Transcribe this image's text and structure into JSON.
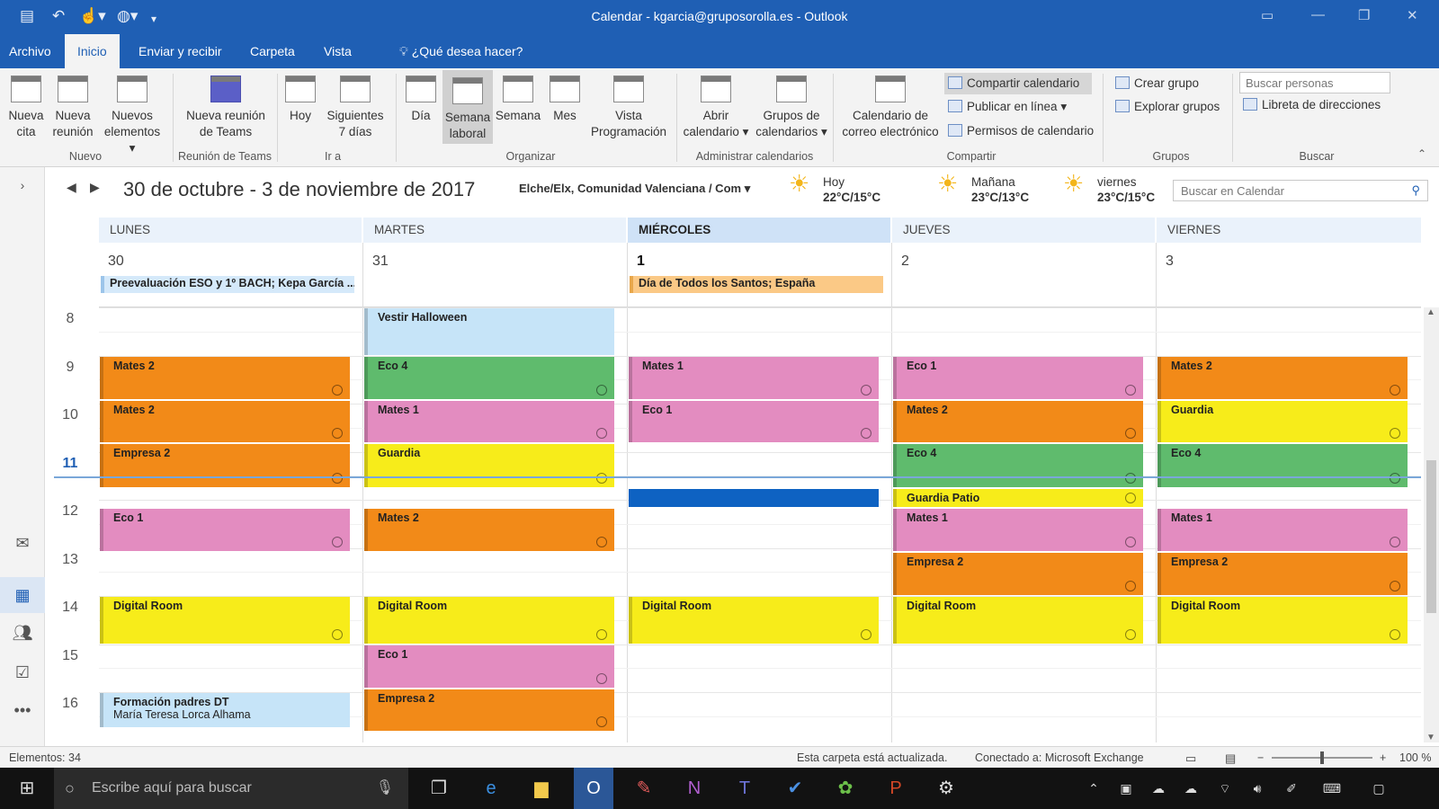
{
  "window": {
    "title": "Calendar - kgarcia@gruposorolla.es - Outlook"
  },
  "tabs": [
    "Archivo",
    "Inicio",
    "Enviar y recibir",
    "Carpeta",
    "Vista",
    "¿Qué desea hacer?"
  ],
  "ribbon": {
    "nueva_cita": "Nueva\ncita",
    "nueva_reunion": "Nueva\nreunión",
    "nuevos_elementos": "Nuevos\nelementos ▾",
    "teams": "Nueva reunión\nde Teams",
    "hoy": "Hoy",
    "siguientes": "Siguientes\n7 días",
    "dia": "Día",
    "semana_laboral": "Semana\nlaboral",
    "semana": "Semana",
    "mes": "Mes",
    "vista_prog": "Vista\nProgramación",
    "abrir": "Abrir\ncalendario ▾",
    "grupos_cal": "Grupos de\ncalendarios ▾",
    "cal_correo": "Calendario de\ncorreo electrónico",
    "compartir": "Compartir calendario",
    "publicar": "Publicar en línea ▾",
    "permisos": "Permisos de calendario",
    "crear_grupo": "Crear grupo",
    "explorar": "Explorar grupos",
    "buscar_personas": "Buscar personas",
    "libreta": "Libreta de direcciones",
    "groups": {
      "nuevo": "Nuevo",
      "teams": "Reunión de Teams",
      "ira": "Ir a",
      "organizar": "Organizar",
      "admin": "Administrar calendarios",
      "compartir": "Compartir",
      "grupos": "Grupos",
      "buscar": "Buscar"
    }
  },
  "header": {
    "date_range": "30 de octubre - 3 de noviembre de 2017",
    "location": "Elche/Elx, Comunidad Valenciana / Com",
    "weather": [
      {
        "label": "Hoy",
        "temp": "22°C/15°C"
      },
      {
        "label": "Mañana",
        "temp": "23°C/13°C"
      },
      {
        "label": "viernes",
        "temp": "23°C/15°C"
      }
    ],
    "search_placeholder": "Buscar en Calendar"
  },
  "days": [
    {
      "name": "LUNES",
      "num": "30"
    },
    {
      "name": "MARTES",
      "num": "31"
    },
    {
      "name": "MIÉRCOLES",
      "num": "1"
    },
    {
      "name": "JUEVES",
      "num": "2"
    },
    {
      "name": "VIERNES",
      "num": "3"
    }
  ],
  "allday": [
    "Preevaluación ESO y 1º BACH; Kepa García ...",
    "Día de Todos los Santos; España"
  ],
  "hours": [
    "8",
    "9",
    "10",
    "11",
    "12",
    "13",
    "14",
    "15",
    "16"
  ],
  "events": [
    {
      "day": 0,
      "start": 9,
      "end": 9.92,
      "title": "Mates 2",
      "color": "orange",
      "recurring": true
    },
    {
      "day": 0,
      "start": 9.92,
      "end": 10.83,
      "title": "Mates 2",
      "color": "orange",
      "recurring": true
    },
    {
      "day": 0,
      "start": 10.83,
      "end": 11.75,
      "title": "Empresa 2",
      "color": "orange",
      "recurring": true
    },
    {
      "day": 0,
      "start": 12.17,
      "end": 13.08,
      "title": "Eco 1",
      "color": "pink",
      "recurring": true
    },
    {
      "day": 0,
      "start": 14,
      "end": 15,
      "title": "Digital Room",
      "color": "yellow",
      "recurring": true
    },
    {
      "day": 0,
      "start": 16,
      "end": 16.75,
      "title": "Formación padres DT",
      "sub": "María Teresa Lorca Alhama",
      "color": "lblue",
      "recurring": false
    },
    {
      "day": 1,
      "start": 8,
      "end": 9,
      "title": "Vestir Halloween",
      "color": "lblue",
      "recurring": false
    },
    {
      "day": 1,
      "start": 9,
      "end": 9.92,
      "title": "Eco 4",
      "color": "green",
      "recurring": true
    },
    {
      "day": 1,
      "start": 9.92,
      "end": 10.83,
      "title": "Mates 1",
      "color": "pink",
      "recurring": true
    },
    {
      "day": 1,
      "start": 10.83,
      "end": 11.75,
      "title": "Guardia",
      "color": "yellow",
      "recurring": true
    },
    {
      "day": 1,
      "start": 12.17,
      "end": 13.08,
      "title": "Mates 2",
      "color": "orange",
      "recurring": true
    },
    {
      "day": 1,
      "start": 14,
      "end": 15,
      "title": "Digital Room",
      "color": "yellow",
      "recurring": true
    },
    {
      "day": 1,
      "start": 15,
      "end": 15.92,
      "title": "Eco 1",
      "color": "pink",
      "recurring": true
    },
    {
      "day": 1,
      "start": 15.92,
      "end": 16.83,
      "title": "Empresa 2",
      "color": "orange",
      "recurring": true
    },
    {
      "day": 2,
      "start": 9,
      "end": 9.92,
      "title": "Mates 1",
      "color": "pink",
      "recurring": true
    },
    {
      "day": 2,
      "start": 9.92,
      "end": 10.83,
      "title": "Eco 1",
      "color": "pink",
      "recurring": true
    },
    {
      "day": 2,
      "start": 11.75,
      "end": 12.17,
      "title": "",
      "color": "dblue",
      "recurring": false
    },
    {
      "day": 2,
      "start": 14,
      "end": 15,
      "title": "Digital Room",
      "color": "yellow",
      "recurring": true
    },
    {
      "day": 3,
      "start": 9,
      "end": 9.92,
      "title": "Eco 1",
      "color": "pink",
      "recurring": true
    },
    {
      "day": 3,
      "start": 9.92,
      "end": 10.83,
      "title": "Mates 2",
      "color": "orange",
      "recurring": true
    },
    {
      "day": 3,
      "start": 10.83,
      "end": 11.75,
      "title": "Eco 4",
      "color": "green",
      "recurring": true
    },
    {
      "day": 3,
      "start": 11.75,
      "end": 12.17,
      "title": "Guardia Patio",
      "color": "yellow",
      "recurring": true
    },
    {
      "day": 3,
      "start": 12.17,
      "end": 13.08,
      "title": "Mates 1",
      "color": "pink",
      "recurring": true
    },
    {
      "day": 3,
      "start": 13.08,
      "end": 14,
      "title": "Empresa 2",
      "color": "orange",
      "recurring": true
    },
    {
      "day": 3,
      "start": 14,
      "end": 15,
      "title": "Digital Room",
      "color": "yellow",
      "recurring": true
    },
    {
      "day": 4,
      "start": 9,
      "end": 9.92,
      "title": "Mates 2",
      "color": "orange",
      "recurring": true
    },
    {
      "day": 4,
      "start": 9.92,
      "end": 10.83,
      "title": "Guardia",
      "color": "yellow",
      "recurring": true
    },
    {
      "day": 4,
      "start": 10.83,
      "end": 11.75,
      "title": "Eco 4",
      "color": "green",
      "recurring": true
    },
    {
      "day": 4,
      "start": 12.17,
      "end": 13.08,
      "title": "Mates 1",
      "color": "pink",
      "recurring": true
    },
    {
      "day": 4,
      "start": 13.08,
      "end": 14,
      "title": "Empresa 2",
      "color": "orange",
      "recurring": true
    },
    {
      "day": 4,
      "start": 14,
      "end": 15,
      "title": "Digital Room",
      "color": "yellow",
      "recurring": true
    }
  ],
  "status": {
    "items": "Elementos: 34",
    "folder": "Esta carpeta está actualizada.",
    "connected": "Conectado a: Microsoft Exchange",
    "zoom": "100 %"
  },
  "taskbar": {
    "search_placeholder": "Escribe aquí para buscar"
  }
}
